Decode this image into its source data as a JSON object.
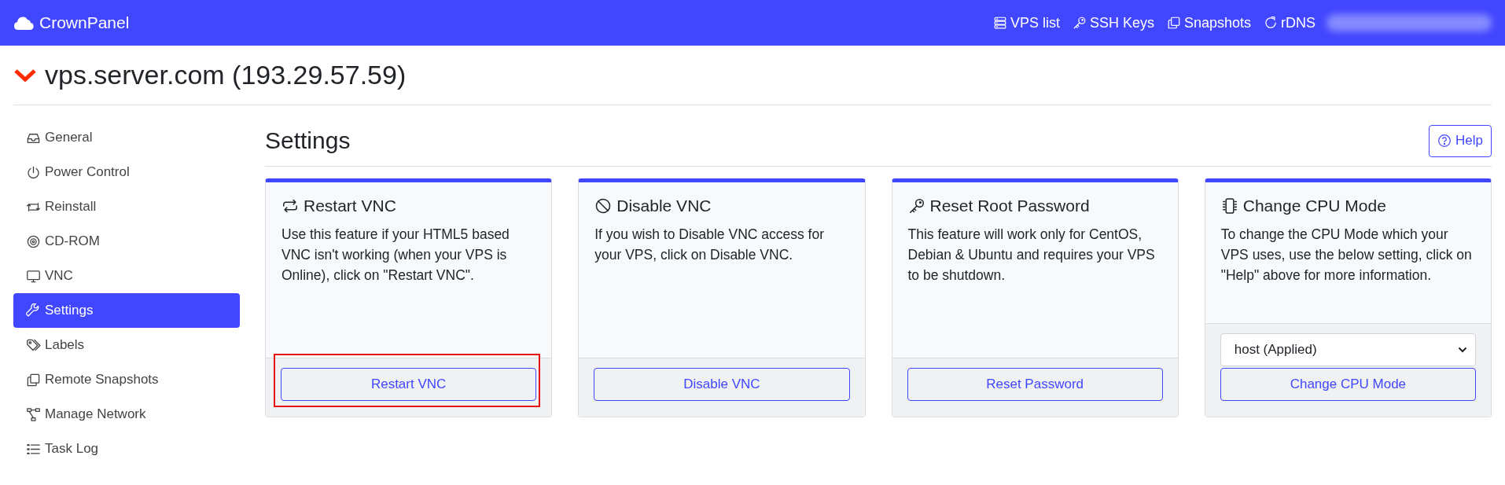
{
  "brand": {
    "name": "CrownPanel"
  },
  "top_nav": [
    {
      "label": "VPS list"
    },
    {
      "label": "SSH Keys"
    },
    {
      "label": "Snapshots"
    },
    {
      "label": "rDNS"
    }
  ],
  "server_title": "vps.server.com (193.29.57.59)",
  "sidebar": {
    "items": [
      {
        "label": "General",
        "selected": false
      },
      {
        "label": "Power Control",
        "selected": false
      },
      {
        "label": "Reinstall",
        "selected": false
      },
      {
        "label": "CD-ROM",
        "selected": false
      },
      {
        "label": "VNC",
        "selected": false
      },
      {
        "label": "Settings",
        "selected": true
      },
      {
        "label": "Labels",
        "selected": false
      },
      {
        "label": "Remote Snapshots",
        "selected": false
      },
      {
        "label": "Manage Network",
        "selected": false
      },
      {
        "label": "Task Log",
        "selected": false
      }
    ]
  },
  "page": {
    "title": "Settings",
    "help_button": "Help"
  },
  "cards": [
    {
      "kind": "button",
      "title": "Restart VNC",
      "description": "Use this feature if your HTML5 based VNC isn't working (when your VPS is Online), click on \"Restart VNC\".",
      "button": "Restart VNC",
      "highlighted": true
    },
    {
      "kind": "button",
      "title": "Disable VNC",
      "description": "If you wish to Disable VNC access for your VPS, click on Disable VNC.",
      "button": "Disable VNC",
      "highlighted": false
    },
    {
      "kind": "button",
      "title": "Reset Root Password",
      "description": "This feature will work only for CentOS, Debian & Ubuntu and requires your VPS to be shutdown.",
      "button": "Reset Password",
      "highlighted": false
    },
    {
      "kind": "select",
      "title": "Change CPU Mode",
      "description": "To change the CPU Mode which your VPS uses, use the below setting, click on \"Help\" above for more information.",
      "select_value": "host (Applied)",
      "button": "Change CPU Mode",
      "highlighted": false
    }
  ]
}
